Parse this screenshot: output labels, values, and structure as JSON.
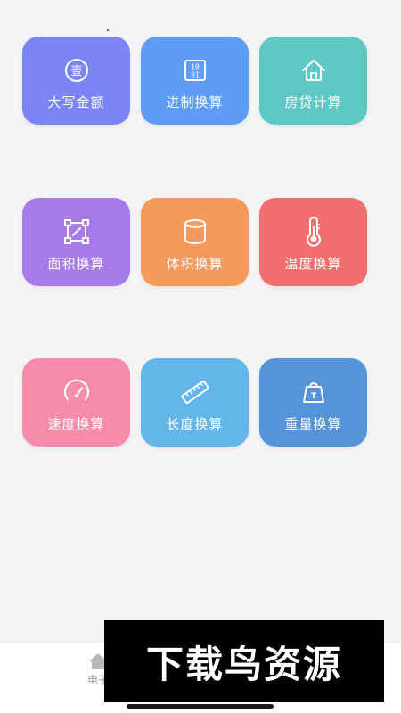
{
  "colors": {
    "background": "#f4f4f6",
    "tile_rmb": "#7b85f5",
    "tile_base": "#5f9cf5",
    "tile_mortgage": "#5ec8c4",
    "tile_area": "#a87ce8",
    "tile_volume": "#f59a5c",
    "tile_temperature": "#f26f6f",
    "tile_speed": "#f78bab",
    "tile_length": "#62b6ea",
    "tile_weight": "#5594d8"
  },
  "tools": [
    {
      "label": "大写金额",
      "icon": "rmb-capital-icon",
      "badge": "壹"
    },
    {
      "label": "进制换算",
      "icon": "binary-icon",
      "badge_top": "10",
      "badge_bottom": "01"
    },
    {
      "label": "房贷计算",
      "icon": "house-icon"
    },
    {
      "label": "面积换算",
      "icon": "area-icon"
    },
    {
      "label": "体积换算",
      "icon": "cylinder-icon"
    },
    {
      "label": "温度换算",
      "icon": "thermometer-icon"
    },
    {
      "label": "速度换算",
      "icon": "speedometer-icon"
    },
    {
      "label": "长度换算",
      "icon": "ruler-icon"
    },
    {
      "label": "重量换算",
      "icon": "weight-icon",
      "badge": "T"
    }
  ],
  "tabbar": {
    "home_label": "电子",
    "home_icon": "home-icon"
  },
  "watermark": {
    "text": "下载鸟资源"
  }
}
